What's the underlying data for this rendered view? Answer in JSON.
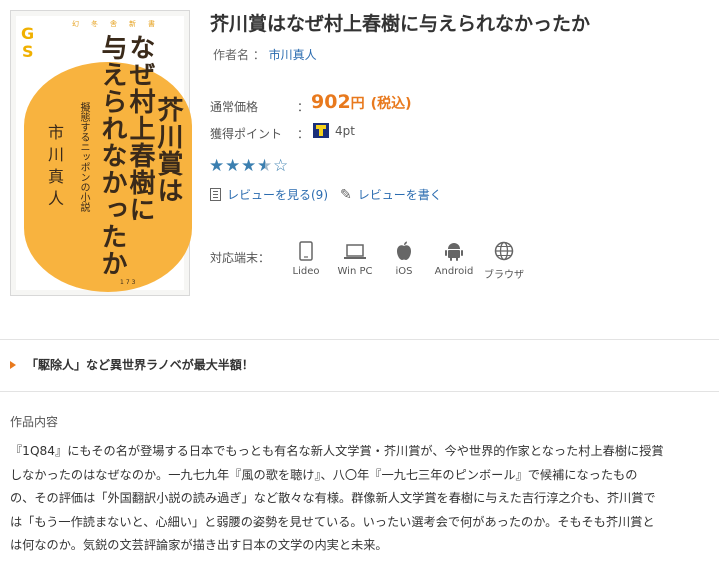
{
  "cover": {
    "logo": "GS",
    "series": "幻冬舎新書",
    "title_line1": "芥川賞は",
    "title_line2": "なぜ村上春樹に",
    "title_line3": "与えられなかったか",
    "subtitle": "擬態するニッポンの小説",
    "author": "市川真人",
    "number": "173"
  },
  "title": "芥川賞はなぜ村上春樹に与えられなかったか",
  "author": {
    "label": "作者名 ：",
    "name": "市川真人"
  },
  "price": {
    "label": "通常価格",
    "colon": "：",
    "amount": "902",
    "yen": "円",
    "tax": "(税込)"
  },
  "points": {
    "label": "獲得ポイント",
    "colon": "：",
    "value": "4pt"
  },
  "rating": {
    "stars": 3.5,
    "max": 5,
    "star_full": "★",
    "star_empty": "☆"
  },
  "reviews": {
    "see": "レビューを見る(9)",
    "write": "レビューを書く"
  },
  "devices": {
    "label": "対応端末：",
    "items": [
      "Lideo",
      "Win PC",
      "iOS",
      "Android",
      "ブラウザ"
    ]
  },
  "campaign": "「駆除人」など異世界ラノベが最大半額！",
  "section_title": "作品内容",
  "description": [
    "『1Q84』にもその名が登場する日本でもっとも有名な新人文学賞・芥川賞が、今や世界的作家となった村上春樹に授賞",
    "しなかったのはなぜなのか。一九七九年『風の歌を聴け』、八〇年『一九七三年のピンボール』で候補になったもの",
    "の、その評価は「外国翻訳小説の読み過ぎ」など散々な有様。群像新人文学賞を春樹に与えた吉行淳之介も、芥川賞で",
    "は「もう一作読まないと、心細い」と弱腰の姿勢を見せている。いったい選考会で何があったのか。そもそも芥川賞と",
    "は何なのか。気鋭の文芸評論家が描き出す日本の文学の内実と未来。"
  ],
  "colors": {
    "accent": "#e8791d",
    "link": "#2b6cb0",
    "star": "#3b7fb0",
    "cover": "#f8b33f"
  }
}
